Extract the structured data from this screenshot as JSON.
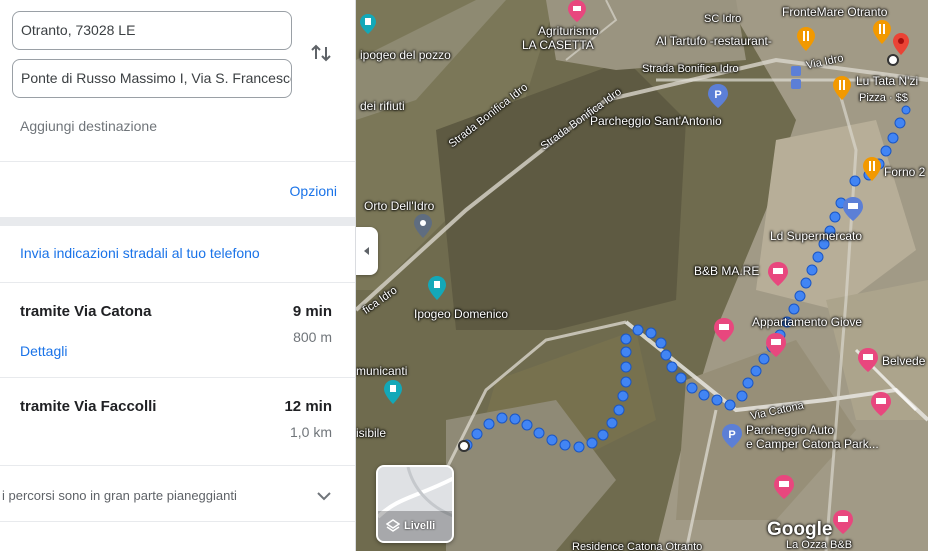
{
  "directions": {
    "origin": "Otranto, 73028 LE",
    "destination": "Ponte di Russo Massimo I, Via S. Francesco",
    "add_destination": "Aggiungi destinazione",
    "options": "Opzioni",
    "send_to_phone": "Invia indicazioni stradali al tuo telefono"
  },
  "routes": [
    {
      "title": "tramite Via Catona",
      "time": "9 min",
      "distance": "800 m",
      "details": "Dettagli"
    },
    {
      "title": "tramite Via Faccolli",
      "time": "12 min",
      "distance": "1,0 km"
    }
  ],
  "terrain_note": "i percorsi sono in gran parte pianeggianti",
  "map": {
    "labels": {
      "ipogeo_pozzo": "ipogeo del pozzo",
      "agriturismo": "Agriturismo",
      "la_casetta": "LA CASETTA",
      "sc_idro": "SC Idro",
      "frontemare": "FronteMare Otranto",
      "al_tartufo": "Al Tartufo -restaurant-",
      "strada_idro": "Strada Bonifica Idro",
      "via_idro": "Via Idro",
      "lu_tata": "Lu Tata N'zi",
      "pizza": "Pizza · $$",
      "rifiuti": "dei rifiuti",
      "parcheggio_antonio": "Parcheggio Sant'Antonio",
      "forno": "Forno 2",
      "orto": "Orto Dell'Idro",
      "ld": "Ld Supermercato",
      "bb_ma_re": "B&B MA.RE",
      "ipogeo_domenico": "Ipogeo Domenico",
      "appartamento": "Appartamento Giove",
      "belvedere": "Belvede",
      "comunicanti": "municanti",
      "via_catona": "Via Catona",
      "parcheggio_auto": "Parcheggio Auto",
      "camper": "e Camper Catona Park...",
      "visibile": "isibile",
      "fica_idro": "fica Idro",
      "la_ozza": "La Ozza B&B",
      "residence": "Residence Catona Otranto"
    },
    "layers_label": "Livelli",
    "logo": "Google"
  },
  "colors": {
    "route_blue": "#4285f4",
    "link_blue": "#1a73e8",
    "hotel_pink": "#e8477e",
    "food_orange": "#f29900",
    "parking_blue": "#5c7fd6",
    "attraction_teal": "#13a8b8",
    "destination_red": "#ea4335"
  },
  "icons": [
    "swap-icon",
    "chevron-down-icon",
    "chevron-left-icon",
    "layers-icon",
    "parking-icon",
    "hotel-icon",
    "restaurant-icon",
    "cart-icon",
    "attraction-icon",
    "destination-pin-icon",
    "bus-icon",
    "shopping-icon"
  ]
}
